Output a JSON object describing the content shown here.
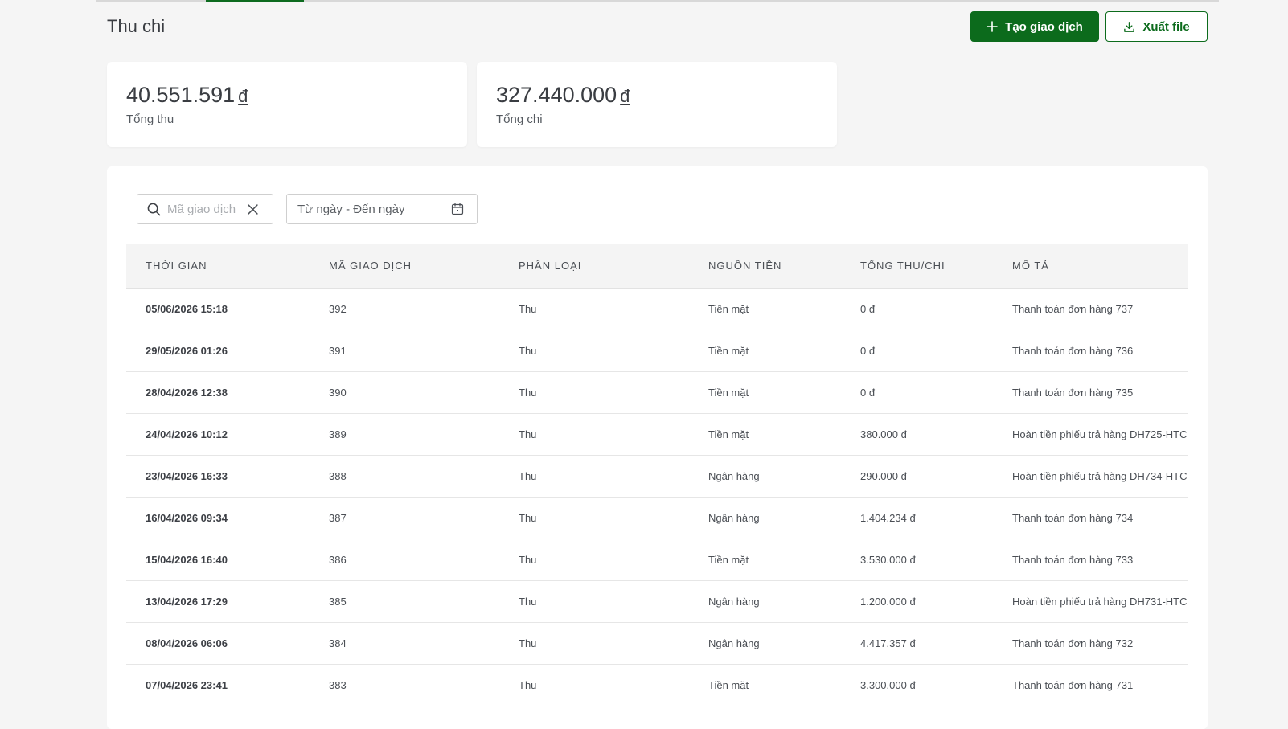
{
  "header": {
    "title": "Thu chi",
    "create_button": "Tạo giao dịch",
    "export_button": "Xuất file"
  },
  "summary": {
    "income": {
      "value": "40.551.591",
      "currency": "đ",
      "label": "Tổng thu"
    },
    "expense": {
      "value": "327.440.000",
      "currency": "đ",
      "label": "Tổng chi"
    }
  },
  "filters": {
    "search_placeholder": "Mã giao dịch",
    "date_placeholder": "Từ ngày - Đến ngày"
  },
  "table": {
    "columns": [
      "THỜI GIAN",
      "MÃ GIAO DỊCH",
      "PHÂN LOẠI",
      "NGUỒN TIỀN",
      "TỔNG THU/CHI",
      "MÔ TẢ"
    ],
    "rows": [
      {
        "time": "05/06/2026 15:18",
        "code": "392",
        "type": "Thu",
        "source": "Tiền mặt",
        "amount": "0 đ",
        "desc": "Thanh toán đơn hàng 737"
      },
      {
        "time": "29/05/2026 01:26",
        "code": "391",
        "type": "Thu",
        "source": "Tiền mặt",
        "amount": "0 đ",
        "desc": "Thanh toán đơn hàng 736"
      },
      {
        "time": "28/04/2026 12:38",
        "code": "390",
        "type": "Thu",
        "source": "Tiền mặt",
        "amount": "0 đ",
        "desc": "Thanh toán đơn hàng 735"
      },
      {
        "time": "24/04/2026 10:12",
        "code": "389",
        "type": "Thu",
        "source": "Tiền mặt",
        "amount": "380.000 đ",
        "desc": "Hoàn tiền phiếu trả hàng DH725-HTC"
      },
      {
        "time": "23/04/2026 16:33",
        "code": "388",
        "type": "Thu",
        "source": "Ngân hàng",
        "amount": "290.000 đ",
        "desc": "Hoàn tiền phiếu trả hàng DH734-HTC"
      },
      {
        "time": "16/04/2026 09:34",
        "code": "387",
        "type": "Thu",
        "source": "Ngân hàng",
        "amount": "1.404.234 đ",
        "desc": "Thanh toán đơn hàng 734"
      },
      {
        "time": "15/04/2026 16:40",
        "code": "386",
        "type": "Thu",
        "source": "Tiền mặt",
        "amount": "3.530.000 đ",
        "desc": "Thanh toán đơn hàng 733"
      },
      {
        "time": "13/04/2026 17:29",
        "code": "385",
        "type": "Thu",
        "source": "Ngân hàng",
        "amount": "1.200.000 đ",
        "desc": "Hoàn tiền phiếu trả hàng DH731-HTC"
      },
      {
        "time": "08/04/2026 06:06",
        "code": "384",
        "type": "Thu",
        "source": "Ngân hàng",
        "amount": "4.417.357 đ",
        "desc": "Thanh toán đơn hàng 732"
      },
      {
        "time": "07/04/2026 23:41",
        "code": "383",
        "type": "Thu",
        "source": "Tiền mặt",
        "amount": "3.300.000 đ",
        "desc": "Thanh toán đơn hàng 731"
      }
    ]
  },
  "colors": {
    "primary": "#0c6b1c",
    "background": "#f5f5f5",
    "header_row": "#f4f4f4"
  },
  "icons": {
    "create": "plus-icon",
    "export": "download-icon",
    "search": "search-icon",
    "clear": "close-icon",
    "date": "calendar-icon"
  }
}
